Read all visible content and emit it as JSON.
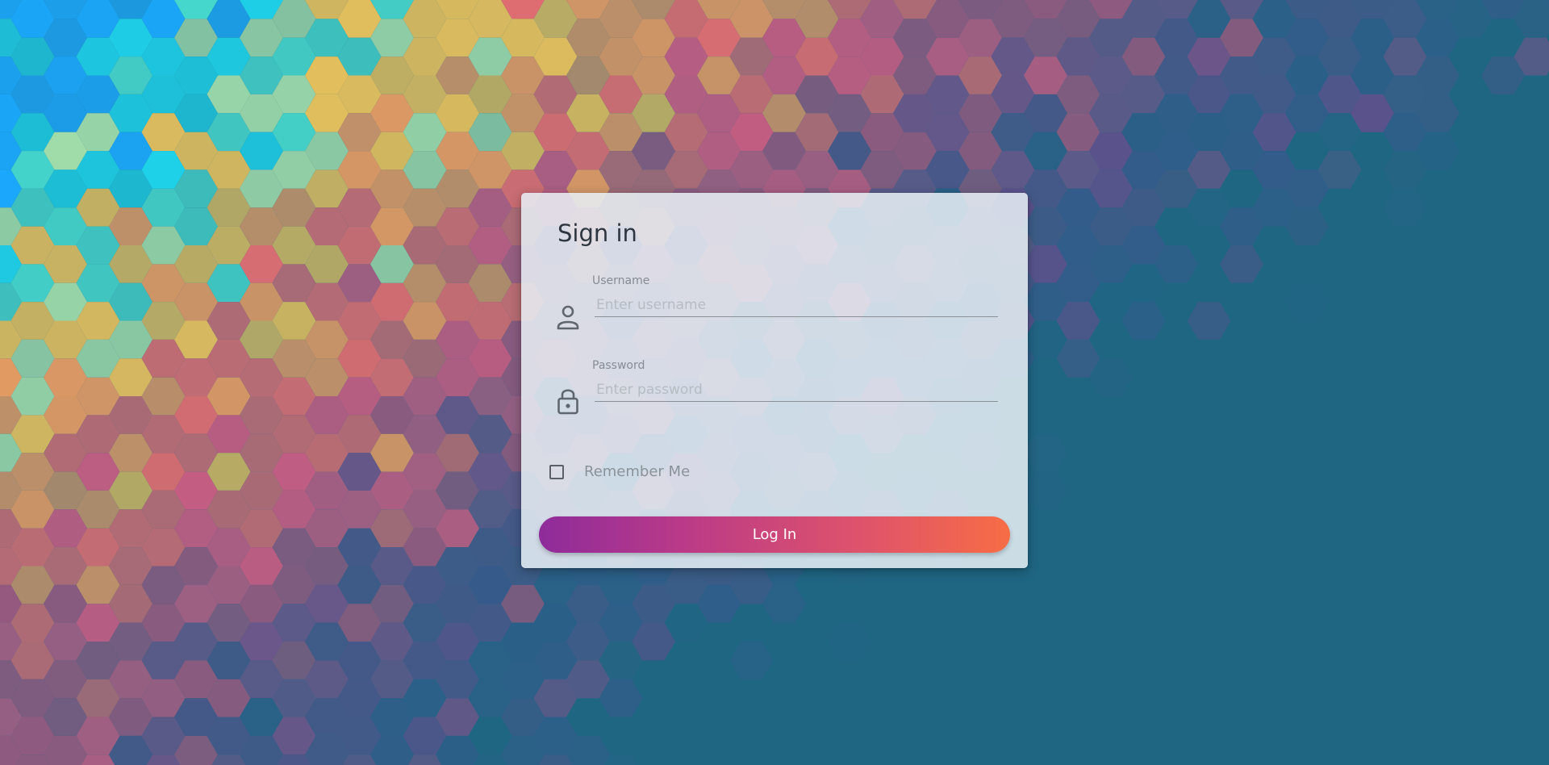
{
  "login": {
    "title": "Sign in",
    "username": {
      "label": "Username",
      "placeholder": "Enter username",
      "value": "",
      "icon": "person-icon"
    },
    "password": {
      "label": "Password",
      "placeholder": "Enter password",
      "value": "",
      "icon": "lock-icon"
    },
    "remember_me": {
      "label": "Remember Me",
      "checked": false
    },
    "submit_label": "Log In"
  },
  "colors": {
    "page_background": "#1f6683",
    "button_gradient_start": "#8e2b9b",
    "button_gradient_end": "#f76d44",
    "title_text": "#2e3640",
    "label_text": "#858c93"
  }
}
